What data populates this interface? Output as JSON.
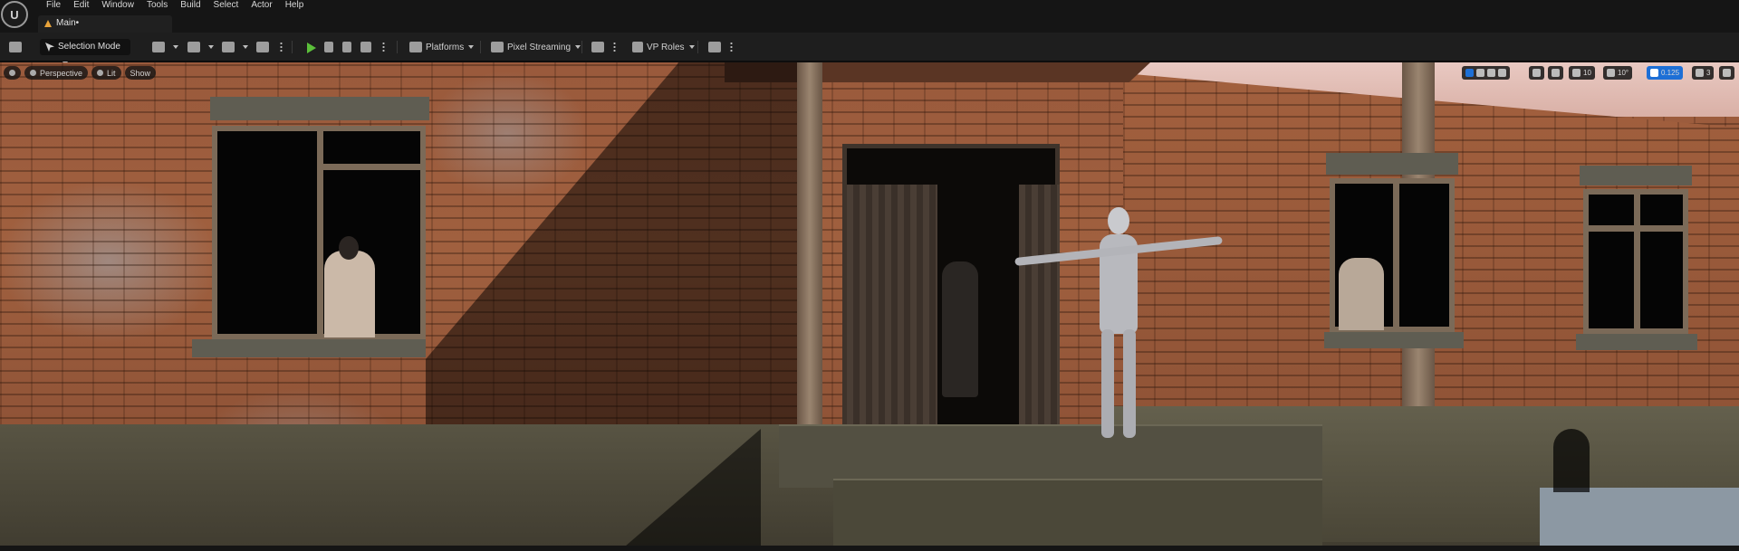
{
  "menu": [
    "File",
    "Edit",
    "Window",
    "Tools",
    "Build",
    "Select",
    "Actor",
    "Help"
  ],
  "logo_glyph": "U",
  "tab": {
    "label": "Main•"
  },
  "toolbar": {
    "selection_mode": "Selection Mode",
    "platforms": "Platforms",
    "pixel_streaming": "Pixel Streaming",
    "vp_roles": "VP Roles"
  },
  "viewport": {
    "perspective": "Perspective",
    "lit": "Lit",
    "show": "Show",
    "grid_snap": "10",
    "rotation_snap": "10°",
    "scale_snap": "0.125",
    "camera_speed": "3"
  },
  "colors": {
    "accent": "#1d6fd6",
    "play": "#5bbf3a",
    "tab_icon": "#e8a33a"
  }
}
